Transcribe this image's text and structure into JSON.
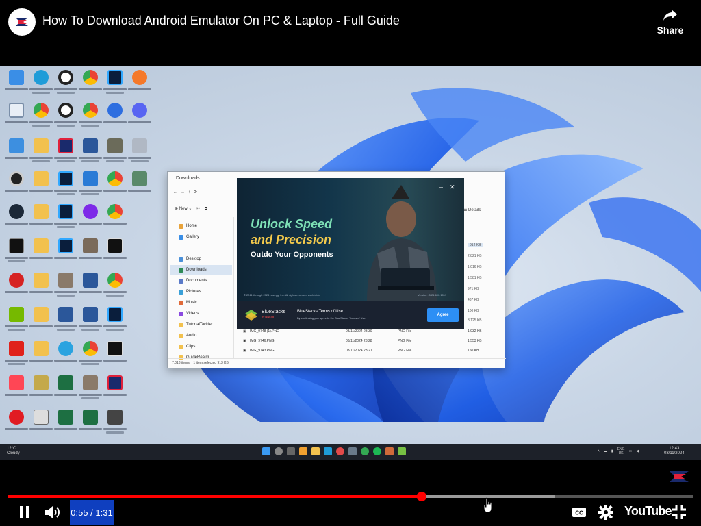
{
  "header": {
    "title": "How To Download Android Emulator On PC & Laptop - Full Guide",
    "share_label": "Share",
    "avatar_icon": "channel-logo-icon",
    "share_icon": "share-arrow-icon"
  },
  "video": {
    "explorer": {
      "title": "Downloads",
      "new_label": "New",
      "details_label": "Details",
      "sidebar": [
        "Home",
        "Gallery",
        "Desktop",
        "Downloads",
        "Documents",
        "Pictures",
        "Music",
        "Videos",
        "TutorialTackler",
        "Audio",
        "Clips",
        "GuideRealm"
      ],
      "sizes": [
        "914 KB",
        "2,821 KB",
        "1,016 KB",
        "1,581 KB",
        "971 KB",
        "467 KB",
        "100 KB",
        "3,125 KB",
        "1,932 KB",
        "1,553 KB",
        "150 KB"
      ],
      "files": [
        {
          "name": "IMG_9748 (1).PNG",
          "date": "03/11/2024 23:30",
          "type": "PNG File"
        },
        {
          "name": "IMG_9746.PNG",
          "date": "03/11/2024 23:28",
          "type": "PNG File"
        },
        {
          "name": "IMG_9743.PNG",
          "date": "03/11/2024 23:21",
          "type": "PNG File"
        }
      ],
      "status_items": "7,018 items",
      "status_selected": "1 item selected  913 KB"
    },
    "bluestacks": {
      "headline_line1": "Unlock Speed",
      "headline_line2": "and Precision",
      "subheadline": "Outdo Your Opponents",
      "copyright": "© 2011 through 2024 now.gg, Inc. All rights reserved worldwide",
      "version": "Version : 5.21.600.1019",
      "brand": "BlueStacks",
      "brand_sub": "by now.gg",
      "terms_title": "BlueStacks Terms of Use",
      "terms_text": "By continuing you agree to the BlueStacks Terms of Use",
      "agree_label": "Agree"
    },
    "taskbar": {
      "weather_temp": "12°C",
      "weather_desc": "Cloudy",
      "lang_top": "ENG",
      "lang_bottom": "UK",
      "time": "12:43",
      "date": "03/11/2024"
    }
  },
  "player": {
    "current_time": "0:55",
    "duration": "1:31",
    "time_display": "0:55 / 1:31",
    "played_fraction": 0.604,
    "buffered_fraction": 0.798,
    "youtube_label": "YouTube",
    "controls": [
      "pause-icon",
      "volume-icon",
      "captions-icon",
      "settings-gear-icon",
      "fullscreen-exit-icon"
    ]
  },
  "colors": {
    "progress_played": "#ff0000",
    "time_highlight": "#0f3fbf",
    "bloom_blue": "#1e5fe0"
  }
}
